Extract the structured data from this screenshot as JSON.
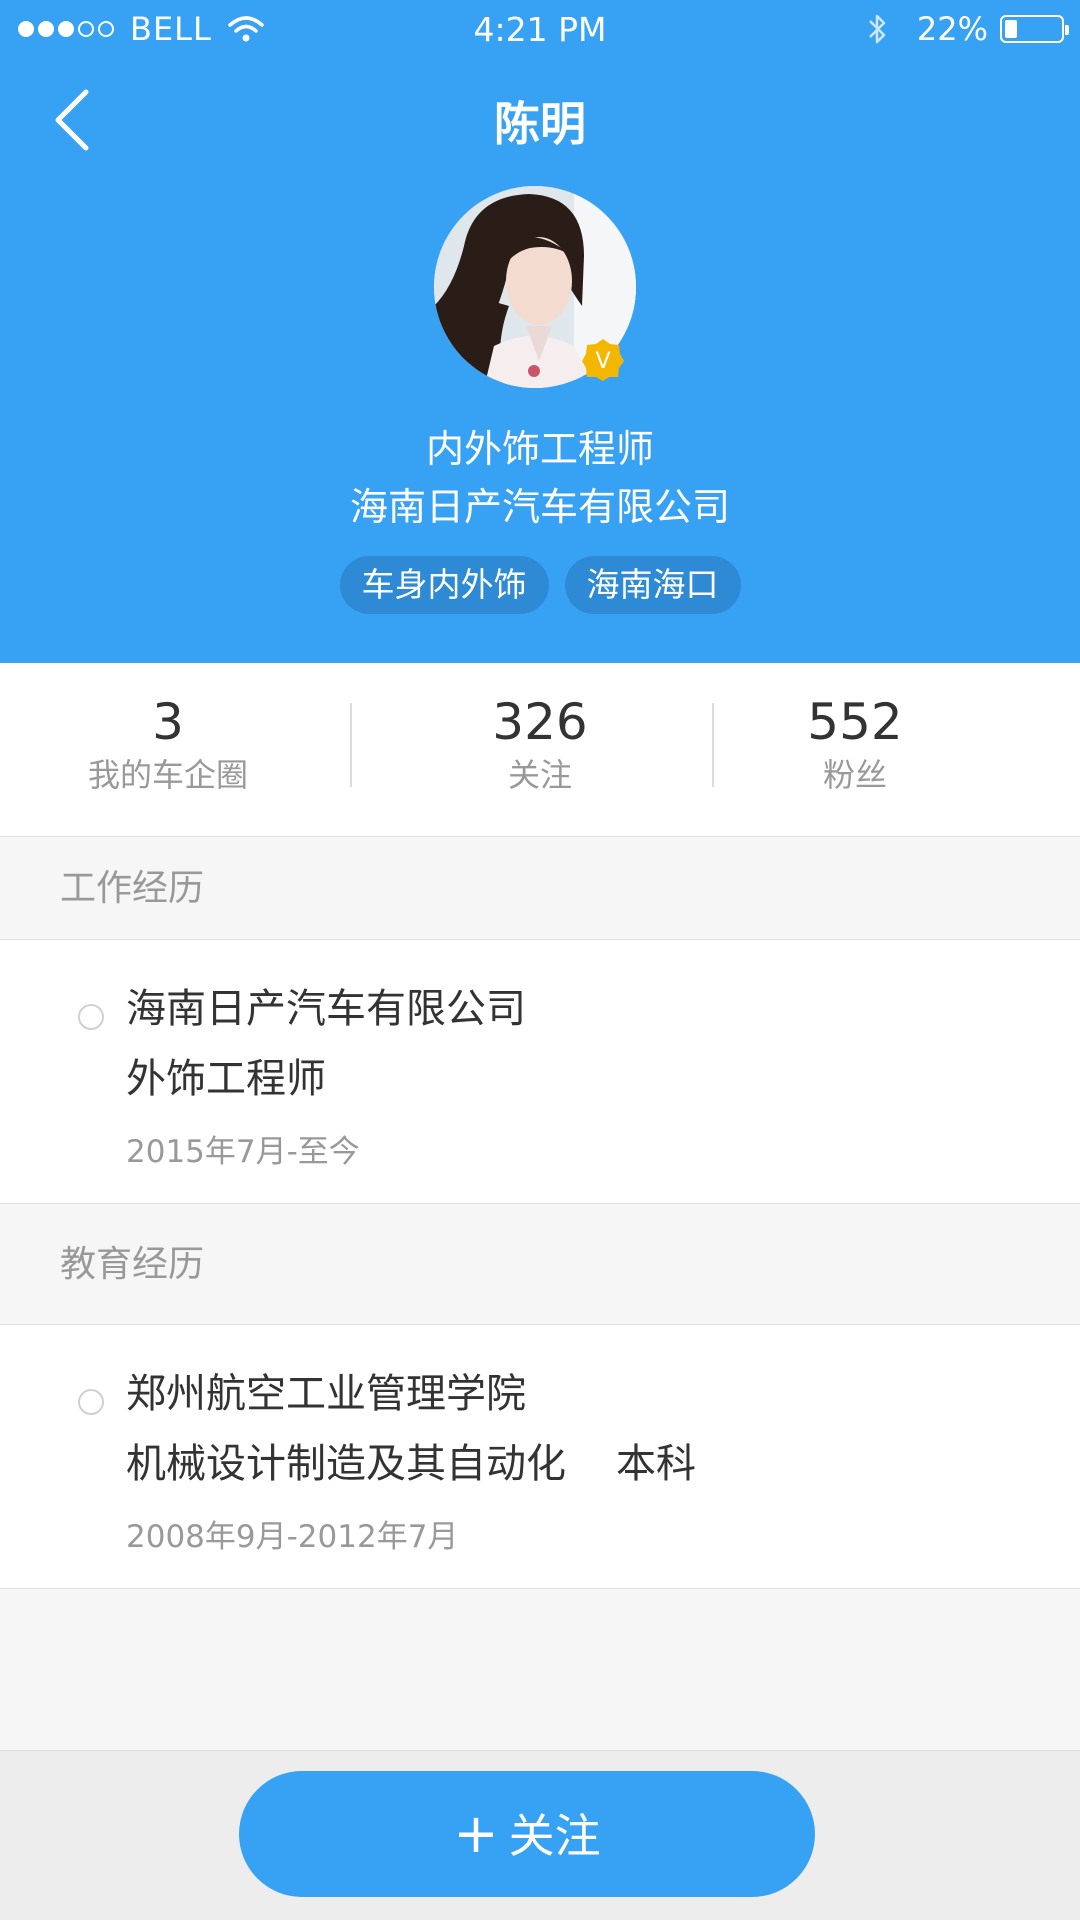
{
  "status_bar": {
    "carrier": "BELL",
    "time": "4:21 PM",
    "battery": "22%",
    "signal_strength": 3,
    "battery_level": 0.22
  },
  "nav": {
    "title": "陈明",
    "back_icon": "chevron-left-icon"
  },
  "profile": {
    "verified_badge": "V",
    "job_title": "内外饰工程师",
    "company": "海南日产汽车有限公司",
    "tags": [
      "车身内外饰",
      "海南海口"
    ]
  },
  "stats": [
    {
      "value": "3",
      "label": "我的车企圈"
    },
    {
      "value": "326",
      "label": "关注"
    },
    {
      "value": "552",
      "label": "粉丝"
    }
  ],
  "work": {
    "section_title": "工作经历",
    "company": "海南日产汽车有限公司",
    "position": "外饰工程师",
    "period": "2015年7月-至今"
  },
  "education": {
    "section_title": "教育经历",
    "school": "郑州航空工业管理学院",
    "major": "机械设计制造及其自动化",
    "degree": "本科",
    "period": "2008年9月-2012年7月"
  },
  "follow_button": {
    "plus": "+",
    "label": "关注"
  },
  "colors": {
    "accent": "#37a2f4",
    "tag_bg": "#2e8ad4",
    "badge": "#f3b700"
  }
}
